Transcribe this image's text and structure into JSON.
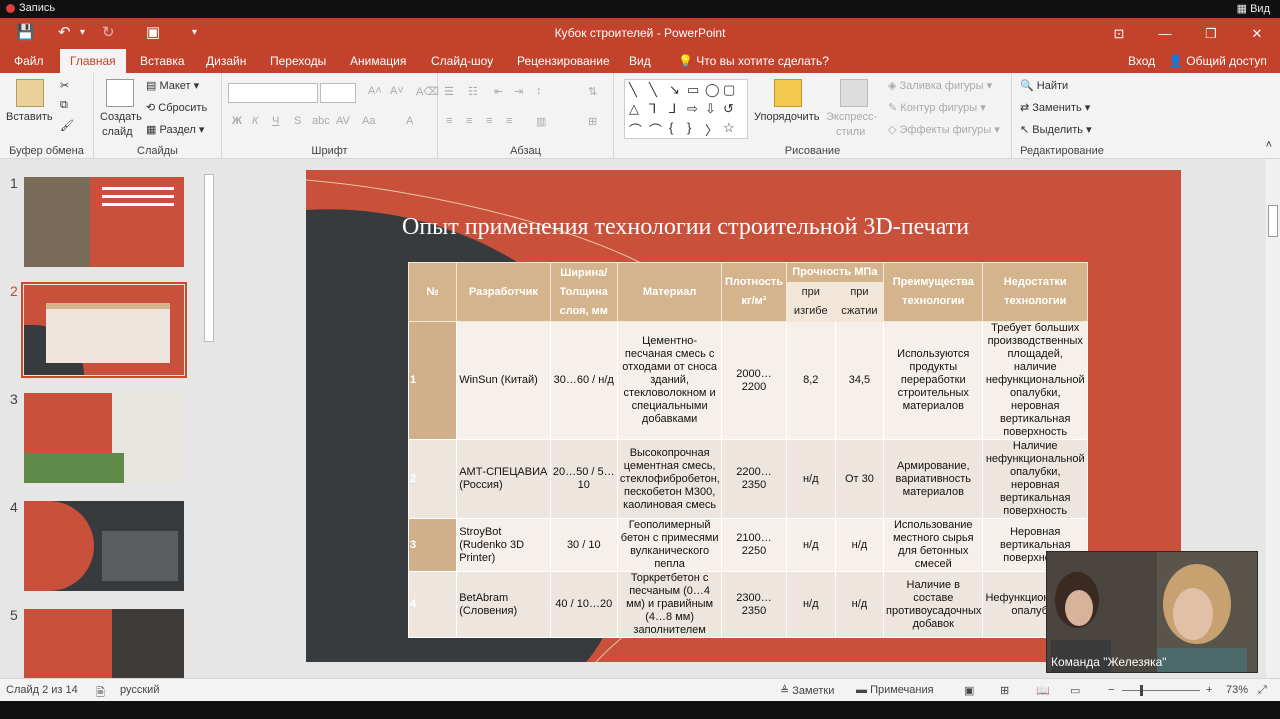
{
  "recorder": {
    "label": "Запись",
    "view_label": "Вид"
  },
  "window": {
    "title": "Кубок строителей - PowerPoint"
  },
  "tabs": [
    {
      "label": "Файл"
    },
    {
      "label": "Главная"
    },
    {
      "label": "Вставка"
    },
    {
      "label": "Дизайн"
    },
    {
      "label": "Переходы"
    },
    {
      "label": "Анимация"
    },
    {
      "label": "Слайд-шоу"
    },
    {
      "label": "Рецензирование"
    },
    {
      "label": "Вид"
    }
  ],
  "search": {
    "placeholder": "Что вы хотите сделать?"
  },
  "account": {
    "signin": "Вход",
    "share": "Общий доступ"
  },
  "ribbon": {
    "clipboard": {
      "paste": "Вставить",
      "label": "Буфер обмена"
    },
    "slides": {
      "new_slide_1": "Создать",
      "new_slide_2": "слайд",
      "layout": "Макет",
      "reset": "Сбросить",
      "section": "Раздел",
      "label": "Слайды"
    },
    "font": {
      "bold": "Ж",
      "italic": "К",
      "underline": "Ч",
      "strike": "S",
      "label": "Шрифт"
    },
    "paragraph": {
      "label": "Абзац"
    },
    "drawing": {
      "arrange": "Упорядочить",
      "quick_styles_1": "Экспресс-",
      "quick_styles_2": "стили",
      "fill": "Заливка фигуры",
      "outline": "Контур фигуры",
      "effects": "Эффекты фигуры",
      "label": "Рисование"
    },
    "editing": {
      "find": "Найти",
      "replace": "Заменить",
      "select": "Выделить",
      "label": "Редактирование"
    }
  },
  "thumbnails": [
    {
      "num": "1"
    },
    {
      "num": "2"
    },
    {
      "num": "3"
    },
    {
      "num": "4"
    },
    {
      "num": "5"
    }
  ],
  "slide": {
    "title": "Опыт применения технологии строительной 3D-печати",
    "headers": {
      "num": "№",
      "dev": "Разработчик",
      "width": "Ширина/ Толщина слоя, мм",
      "material": "Материал",
      "density": "Плотность кг/м²",
      "strength": "Прочность МПа",
      "bend": "при изгибе",
      "compress": "при сжатии",
      "adv": "Преимущества технологии",
      "dis": "Недостатки технологии"
    },
    "rows": [
      {
        "num": "1",
        "dev": "WinSun (Китай)",
        "width": "30…60 / н/д",
        "material": "Цементно-песчаная смесь с отходами от сноса зданий, стекловолокном и специальными добавками",
        "density": "2000…2200",
        "bend": "8,2",
        "compress": "34,5",
        "adv": "Используются продукты переработки строительных материалов",
        "dis": "Требует больших производственных площадей, наличие нефункциональной опалубки, неровная вертикальная поверхность"
      },
      {
        "num": "2",
        "dev": "АМТ-СПЕЦАВИА (Россия)",
        "width": "20…50 / 5…10",
        "material": "Высокопрочная цементная смесь, стеклофибробетон, пескобетон М300, каолиновая смесь",
        "density": "2200…2350",
        "bend": "н/д",
        "compress": "От 30",
        "adv": "Армирование, вариативность материалов",
        "dis": "Наличие нефункциональной опалубки, неровная вертикальная поверхность"
      },
      {
        "num": "3",
        "dev": "StroyBot (Rudenko 3D Printer)",
        "width": "30 / 10",
        "material": "Геополимерный бетон с примесями вулканического пепла",
        "density": "2100…2250",
        "bend": "н/д",
        "compress": "н/д",
        "adv": "Использование местного сырья для бетонных смесей",
        "dis": "Неровная вертикальная поверхность"
      },
      {
        "num": "4",
        "dev": "BetAbram (Словения)",
        "width": "40 / 10…20",
        "material": "Торкретбетон с песчаным (0…4 мм) и гравийным (4…8 мм) заполнителем",
        "density": "2300…2350",
        "bend": "н/д",
        "compress": "н/д",
        "adv": "Наличие в составе противоусадочных добавок",
        "dis": "Нефункциональная опалубка"
      }
    ]
  },
  "video": {
    "label": "Команда \"Железяка\""
  },
  "status": {
    "slide": "Слайд 2 из 14",
    "lang": "русский",
    "notes": "Заметки",
    "comments": "Примечания",
    "zoom": "73%"
  },
  "colors": {
    "accent": "#c2422c",
    "slide_bg": "#c9503b",
    "slide_dark": "#373b3e",
    "table_header": "#d3b48c"
  }
}
